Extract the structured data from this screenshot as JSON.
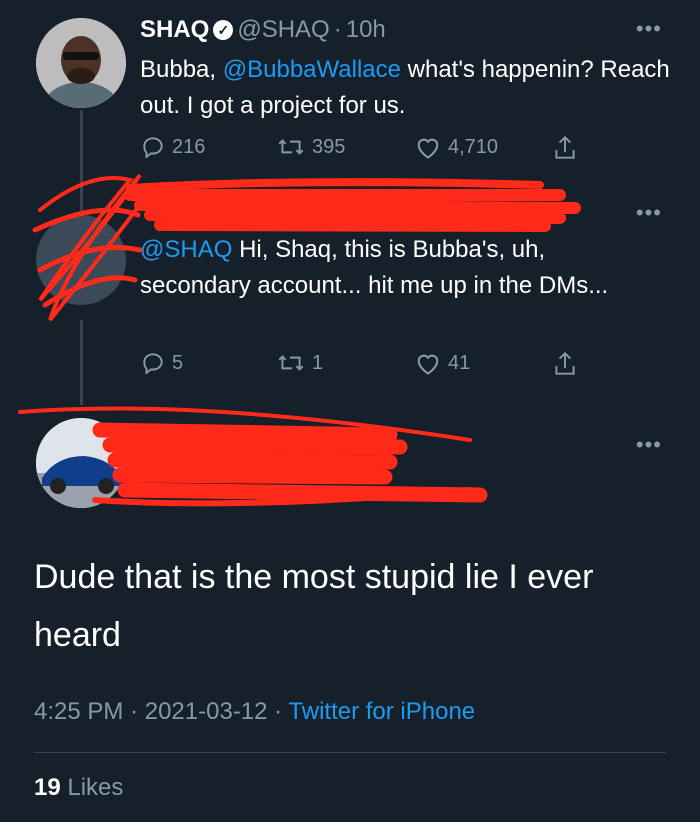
{
  "tweet1": {
    "name": "SHAQ",
    "handle": "@SHAQ",
    "sep": "·",
    "time": "10h",
    "text_pre": "Bubba,",
    "mention": "@BubbaWallace",
    "text_post": "what's happenin? Reach out. I got a project for us.",
    "replies": "216",
    "retweets": "395",
    "likes": "4,710"
  },
  "tweet2": {
    "mention": "@SHAQ",
    "text": "Hi, Shaq, this is Bubba's, uh, secondary account... hit me up in the DMs...",
    "replies": "5",
    "retweets": "1",
    "likes": "41"
  },
  "main": {
    "text": "Dude that is the most stupid lie I ever heard",
    "time": "4:25 PM",
    "dot": "·",
    "date": "2021-03-12",
    "dot2": "·",
    "source": "Twitter for iPhone",
    "like_count": "19",
    "like_label": "Likes"
  },
  "icons": {
    "more": "more-icon",
    "reply": "reply-icon",
    "retweet": "retweet-icon",
    "like": "like-icon",
    "share": "share-icon",
    "verified": "verified-icon"
  },
  "colors": {
    "background": "#15202b",
    "link": "#1d9bf0",
    "muted": "#8899a6",
    "redaction": "#ff2a1a"
  }
}
